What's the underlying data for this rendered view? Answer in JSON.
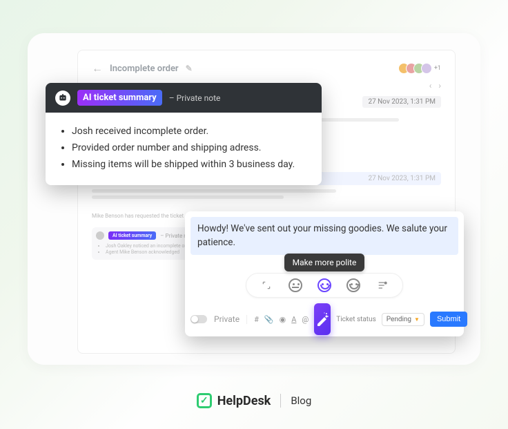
{
  "header": {
    "title": "Incomplete order"
  },
  "thread": {
    "timestamp": "27 Nov 2023, 1:31 PM",
    "sender": "Josh Oakley",
    "agent": "Mike Benson",
    "requested_text": "Mike Benson has requested the ticket"
  },
  "bg_ai": {
    "badge": "AI ticket summary",
    "note": "– Private note",
    "bullets": [
      "Josh Oakley noticed an incomplete order",
      "Agent Mike Benson acknowledged"
    ]
  },
  "summary": {
    "badge": "AI ticket summary",
    "note_label": "– Private note",
    "bullets": [
      "Josh received incomplete order.",
      "Provided order number and shipping adress.",
      "Missing items will be shipped within 3 business day."
    ]
  },
  "composer": {
    "text": "Howdy! We've sent out your missing goodies. We salute your patience.",
    "tooltip": "Make more polite",
    "private_label": "Private",
    "status_label": "Ticket status",
    "status_value": "Pending",
    "submit_label": "Submit"
  },
  "avatars": {
    "extra": "+1"
  },
  "brand": {
    "name": "HelpDesk",
    "section": "Blog"
  }
}
